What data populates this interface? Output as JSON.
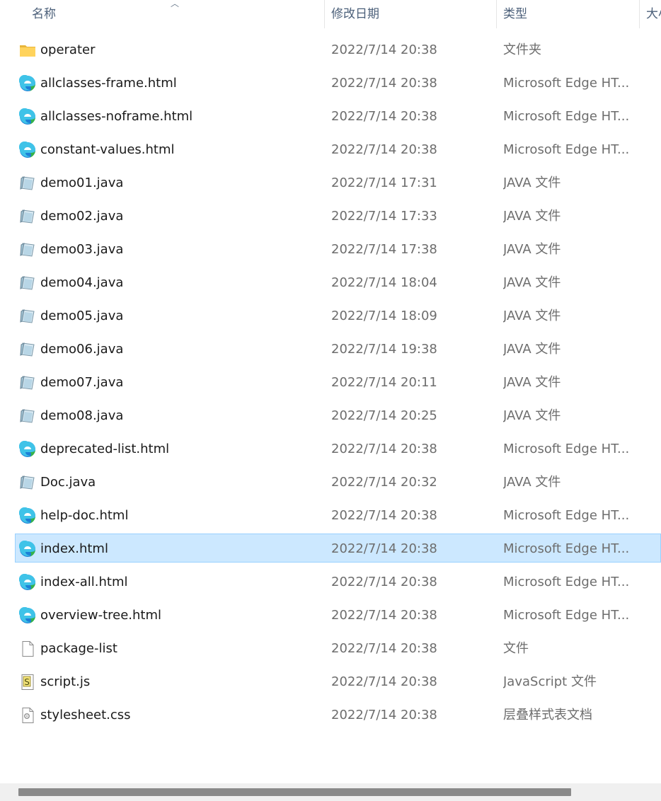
{
  "header": {
    "name": "名称",
    "date": "修改日期",
    "type": "类型",
    "size": "大小"
  },
  "files": [
    {
      "name": "operater",
      "date": "2022/7/14 20:38",
      "type": "文件夹",
      "icon": "folder-icon"
    },
    {
      "name": "allclasses-frame.html",
      "date": "2022/7/14 20:38",
      "type": "Microsoft Edge HT...",
      "icon": "edge-icon"
    },
    {
      "name": "allclasses-noframe.html",
      "date": "2022/7/14 20:38",
      "type": "Microsoft Edge HT...",
      "icon": "edge-icon"
    },
    {
      "name": "constant-values.html",
      "date": "2022/7/14 20:38",
      "type": "Microsoft Edge HT...",
      "icon": "edge-icon"
    },
    {
      "name": "demo01.java",
      "date": "2022/7/14 17:31",
      "type": "JAVA 文件",
      "icon": "java-file-icon"
    },
    {
      "name": "demo02.java",
      "date": "2022/7/14 17:33",
      "type": "JAVA 文件",
      "icon": "java-file-icon"
    },
    {
      "name": "demo03.java",
      "date": "2022/7/14 17:38",
      "type": "JAVA 文件",
      "icon": "java-file-icon"
    },
    {
      "name": "demo04.java",
      "date": "2022/7/14 18:04",
      "type": "JAVA 文件",
      "icon": "java-file-icon"
    },
    {
      "name": "demo05.java",
      "date": "2022/7/14 18:09",
      "type": "JAVA 文件",
      "icon": "java-file-icon"
    },
    {
      "name": "demo06.java",
      "date": "2022/7/14 19:38",
      "type": "JAVA 文件",
      "icon": "java-file-icon"
    },
    {
      "name": "demo07.java",
      "date": "2022/7/14 20:11",
      "type": "JAVA 文件",
      "icon": "java-file-icon"
    },
    {
      "name": "demo08.java",
      "date": "2022/7/14 20:25",
      "type": "JAVA 文件",
      "icon": "java-file-icon"
    },
    {
      "name": "deprecated-list.html",
      "date": "2022/7/14 20:38",
      "type": "Microsoft Edge HT...",
      "icon": "edge-icon"
    },
    {
      "name": "Doc.java",
      "date": "2022/7/14 20:32",
      "type": "JAVA 文件",
      "icon": "java-file-icon"
    },
    {
      "name": "help-doc.html",
      "date": "2022/7/14 20:38",
      "type": "Microsoft Edge HT...",
      "icon": "edge-icon"
    },
    {
      "name": "index.html",
      "date": "2022/7/14 20:38",
      "type": "Microsoft Edge HT...",
      "icon": "edge-icon",
      "selected": true
    },
    {
      "name": "index-all.html",
      "date": "2022/7/14 20:38",
      "type": "Microsoft Edge HT...",
      "icon": "edge-icon"
    },
    {
      "name": "overview-tree.html",
      "date": "2022/7/14 20:38",
      "type": "Microsoft Edge HT...",
      "icon": "edge-icon"
    },
    {
      "name": "package-list",
      "date": "2022/7/14 20:38",
      "type": "文件",
      "icon": "blank-file-icon"
    },
    {
      "name": "script.js",
      "date": "2022/7/14 20:38",
      "type": "JavaScript 文件",
      "icon": "script-file-icon"
    },
    {
      "name": "stylesheet.css",
      "date": "2022/7/14 20:38",
      "type": "层叠样式表文档",
      "icon": "css-file-icon"
    }
  ],
  "colors": {
    "selection_bg": "#cce8ff",
    "selection_border": "#99d1ff",
    "header_text": "#4c607a",
    "meta_text": "#6d6d6d"
  }
}
